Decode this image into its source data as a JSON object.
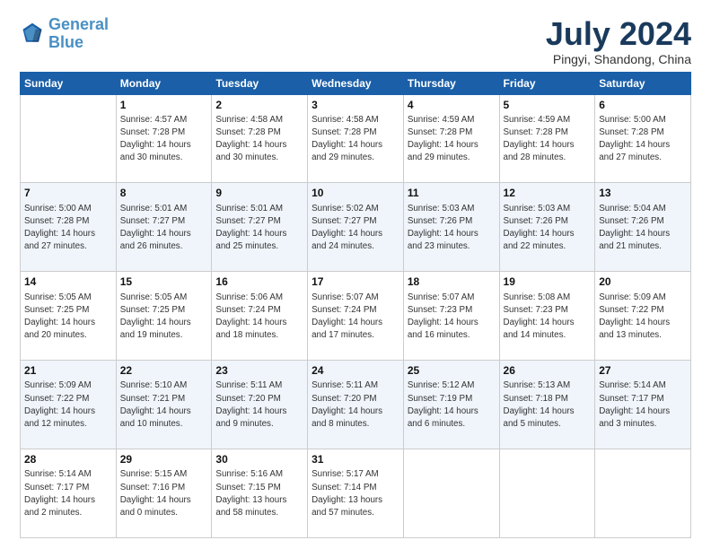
{
  "header": {
    "logo_line1": "General",
    "logo_line2": "Blue",
    "month": "July 2024",
    "location": "Pingyi, Shandong, China"
  },
  "weekdays": [
    "Sunday",
    "Monday",
    "Tuesday",
    "Wednesday",
    "Thursday",
    "Friday",
    "Saturday"
  ],
  "weeks": [
    [
      {
        "day": "",
        "info": ""
      },
      {
        "day": "1",
        "info": "Sunrise: 4:57 AM\nSunset: 7:28 PM\nDaylight: 14 hours\nand 30 minutes."
      },
      {
        "day": "2",
        "info": "Sunrise: 4:58 AM\nSunset: 7:28 PM\nDaylight: 14 hours\nand 30 minutes."
      },
      {
        "day": "3",
        "info": "Sunrise: 4:58 AM\nSunset: 7:28 PM\nDaylight: 14 hours\nand 29 minutes."
      },
      {
        "day": "4",
        "info": "Sunrise: 4:59 AM\nSunset: 7:28 PM\nDaylight: 14 hours\nand 29 minutes."
      },
      {
        "day": "5",
        "info": "Sunrise: 4:59 AM\nSunset: 7:28 PM\nDaylight: 14 hours\nand 28 minutes."
      },
      {
        "day": "6",
        "info": "Sunrise: 5:00 AM\nSunset: 7:28 PM\nDaylight: 14 hours\nand 27 minutes."
      }
    ],
    [
      {
        "day": "7",
        "info": "Sunrise: 5:00 AM\nSunset: 7:28 PM\nDaylight: 14 hours\nand 27 minutes."
      },
      {
        "day": "8",
        "info": "Sunrise: 5:01 AM\nSunset: 7:27 PM\nDaylight: 14 hours\nand 26 minutes."
      },
      {
        "day": "9",
        "info": "Sunrise: 5:01 AM\nSunset: 7:27 PM\nDaylight: 14 hours\nand 25 minutes."
      },
      {
        "day": "10",
        "info": "Sunrise: 5:02 AM\nSunset: 7:27 PM\nDaylight: 14 hours\nand 24 minutes."
      },
      {
        "day": "11",
        "info": "Sunrise: 5:03 AM\nSunset: 7:26 PM\nDaylight: 14 hours\nand 23 minutes."
      },
      {
        "day": "12",
        "info": "Sunrise: 5:03 AM\nSunset: 7:26 PM\nDaylight: 14 hours\nand 22 minutes."
      },
      {
        "day": "13",
        "info": "Sunrise: 5:04 AM\nSunset: 7:26 PM\nDaylight: 14 hours\nand 21 minutes."
      }
    ],
    [
      {
        "day": "14",
        "info": "Sunrise: 5:05 AM\nSunset: 7:25 PM\nDaylight: 14 hours\nand 20 minutes."
      },
      {
        "day": "15",
        "info": "Sunrise: 5:05 AM\nSunset: 7:25 PM\nDaylight: 14 hours\nand 19 minutes."
      },
      {
        "day": "16",
        "info": "Sunrise: 5:06 AM\nSunset: 7:24 PM\nDaylight: 14 hours\nand 18 minutes."
      },
      {
        "day": "17",
        "info": "Sunrise: 5:07 AM\nSunset: 7:24 PM\nDaylight: 14 hours\nand 17 minutes."
      },
      {
        "day": "18",
        "info": "Sunrise: 5:07 AM\nSunset: 7:23 PM\nDaylight: 14 hours\nand 16 minutes."
      },
      {
        "day": "19",
        "info": "Sunrise: 5:08 AM\nSunset: 7:23 PM\nDaylight: 14 hours\nand 14 minutes."
      },
      {
        "day": "20",
        "info": "Sunrise: 5:09 AM\nSunset: 7:22 PM\nDaylight: 14 hours\nand 13 minutes."
      }
    ],
    [
      {
        "day": "21",
        "info": "Sunrise: 5:09 AM\nSunset: 7:22 PM\nDaylight: 14 hours\nand 12 minutes."
      },
      {
        "day": "22",
        "info": "Sunrise: 5:10 AM\nSunset: 7:21 PM\nDaylight: 14 hours\nand 10 minutes."
      },
      {
        "day": "23",
        "info": "Sunrise: 5:11 AM\nSunset: 7:20 PM\nDaylight: 14 hours\nand 9 minutes."
      },
      {
        "day": "24",
        "info": "Sunrise: 5:11 AM\nSunset: 7:20 PM\nDaylight: 14 hours\nand 8 minutes."
      },
      {
        "day": "25",
        "info": "Sunrise: 5:12 AM\nSunset: 7:19 PM\nDaylight: 14 hours\nand 6 minutes."
      },
      {
        "day": "26",
        "info": "Sunrise: 5:13 AM\nSunset: 7:18 PM\nDaylight: 14 hours\nand 5 minutes."
      },
      {
        "day": "27",
        "info": "Sunrise: 5:14 AM\nSunset: 7:17 PM\nDaylight: 14 hours\nand 3 minutes."
      }
    ],
    [
      {
        "day": "28",
        "info": "Sunrise: 5:14 AM\nSunset: 7:17 PM\nDaylight: 14 hours\nand 2 minutes."
      },
      {
        "day": "29",
        "info": "Sunrise: 5:15 AM\nSunset: 7:16 PM\nDaylight: 14 hours\nand 0 minutes."
      },
      {
        "day": "30",
        "info": "Sunrise: 5:16 AM\nSunset: 7:15 PM\nDaylight: 13 hours\nand 58 minutes."
      },
      {
        "day": "31",
        "info": "Sunrise: 5:17 AM\nSunset: 7:14 PM\nDaylight: 13 hours\nand 57 minutes."
      },
      {
        "day": "",
        "info": ""
      },
      {
        "day": "",
        "info": ""
      },
      {
        "day": "",
        "info": ""
      }
    ]
  ]
}
